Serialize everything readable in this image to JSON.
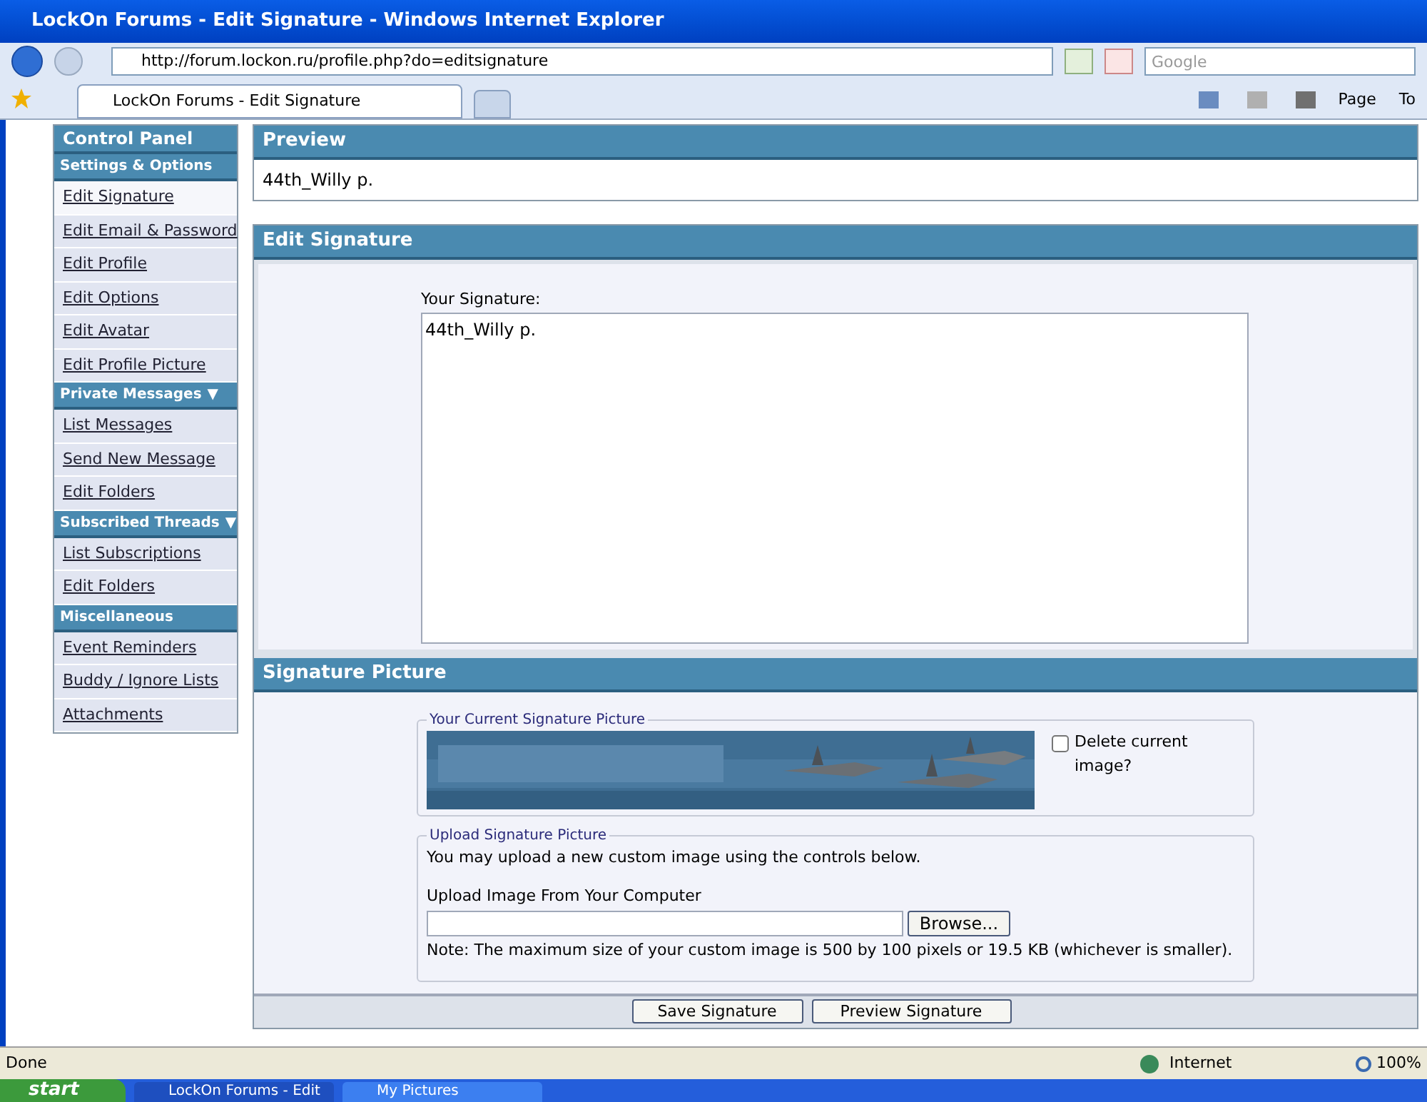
{
  "window": {
    "title": "LockOn Forums - Edit Signature - Windows Internet Explorer"
  },
  "address_bar": {
    "url": "http://forum.lockon.ru/profile.php?do=editsignature",
    "search_placeholder": "Google"
  },
  "tabs": [
    {
      "label": "LockOn Forums - Edit Signature",
      "selected": true
    }
  ],
  "command_bar": [
    "Page",
    "To"
  ],
  "sidebar": {
    "title": "Control Panel",
    "sections": [
      {
        "title": "Settings & Options",
        "items": [
          {
            "label": "Edit Signature",
            "selected": true
          },
          {
            "label": "Edit Email & Password",
            "selected": false
          },
          {
            "label": "Edit Profile",
            "selected": false
          },
          {
            "label": "Edit Options",
            "selected": false
          },
          {
            "label": "Edit Avatar",
            "selected": false
          },
          {
            "label": "Edit Profile Picture",
            "selected": false
          }
        ]
      },
      {
        "title": "Private Messages",
        "arrow": "▼",
        "items": [
          {
            "label": "List Messages",
            "selected": false
          },
          {
            "label": "Send New Message",
            "selected": false
          },
          {
            "label": "Edit Folders",
            "selected": false
          }
        ]
      },
      {
        "title": "Subscribed Threads",
        "arrow": "▼",
        "items": [
          {
            "label": "List Subscriptions",
            "selected": false
          },
          {
            "label": "Edit Folders",
            "selected": false
          }
        ]
      },
      {
        "title": "Miscellaneous",
        "items": [
          {
            "label": "Event Reminders",
            "selected": false
          },
          {
            "label": "Buddy / Ignore Lists",
            "selected": false
          },
          {
            "label": "Attachments",
            "selected": false
          }
        ]
      }
    ]
  },
  "preview": {
    "title": "Preview",
    "text": "44th_Willy p."
  },
  "edit_signature": {
    "title": "Edit Signature",
    "label": "Your Signature:",
    "value": "44th_Willy p."
  },
  "signature_picture": {
    "title": "Signature Picture",
    "current_legend": "Your Current Signature Picture",
    "delete_label": "Delete current image?",
    "delete_checked": false,
    "upload_legend": "Upload Signature Picture",
    "upload_text": "You may upload a new custom image using the controls below.",
    "file_label": "Upload Image From Your Computer",
    "browse": "Browse...",
    "note": "Note: The maximum size of your custom image is 500 by 100 pixels or 19.5 KB (whichever is smaller)."
  },
  "buttons": [
    "Save Signature",
    "Preview Signature"
  ],
  "status_bar": {
    "text": "Done",
    "zone": "Internet",
    "zoom": "100%"
  },
  "taskbar": {
    "start": "start",
    "items": [
      "LockOn Forums - Edit",
      "My Pictures"
    ]
  }
}
